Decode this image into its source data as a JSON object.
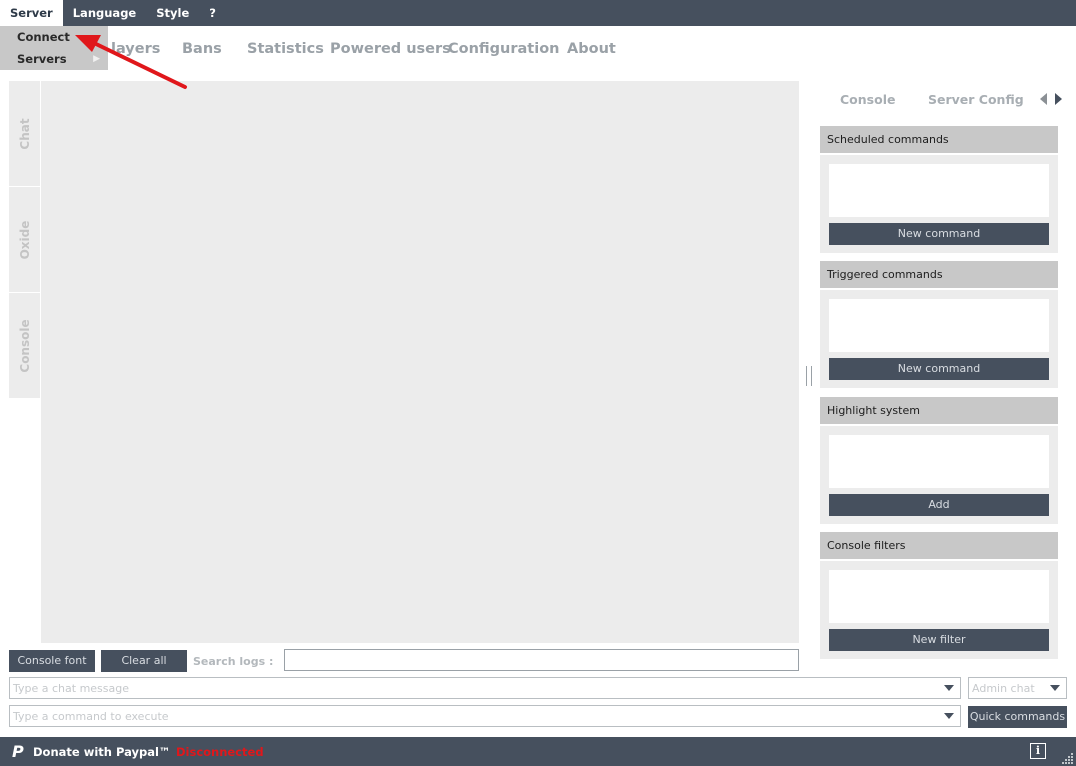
{
  "menubar": {
    "items": [
      {
        "label": "Server"
      },
      {
        "label": "Language"
      },
      {
        "label": "Style"
      },
      {
        "label": "?"
      }
    ]
  },
  "server_menu": {
    "items": [
      {
        "label": "Connect"
      },
      {
        "label": "Servers"
      }
    ]
  },
  "tabs": [
    {
      "label": "layers"
    },
    {
      "label": "Bans"
    },
    {
      "label": "Statistics"
    },
    {
      "label": "Powered users"
    },
    {
      "label": "Configuration"
    },
    {
      "label": "About"
    }
  ],
  "side_tabs": [
    {
      "label": "Chat"
    },
    {
      "label": "Oxide"
    },
    {
      "label": "Console"
    }
  ],
  "right_tabs": [
    {
      "label": "Console"
    },
    {
      "label": "Server Config"
    }
  ],
  "panels": [
    {
      "title": "Scheduled commands",
      "button": "New command"
    },
    {
      "title": "Triggered commands",
      "button": "New command"
    },
    {
      "title": "Highlight system",
      "button": "Add"
    },
    {
      "title": "Console filters",
      "button": "New filter"
    }
  ],
  "toolbar": {
    "console_font": "Console font",
    "clear_all": "Clear all",
    "search_label": "Search logs :"
  },
  "chat_input": {
    "placeholder": "Type a chat message"
  },
  "chat_target": {
    "value": "Admin chat"
  },
  "command_input": {
    "placeholder": "Type a command to execute"
  },
  "quick_commands": "Quick commands",
  "statusbar": {
    "donate": "Donate with Paypal™",
    "status": "Disconnected",
    "info_glyph": "i",
    "paypal_glyph": "P"
  },
  "colors": {
    "menubar_bg": "#46505e",
    "button_bg": "#46505e",
    "panel_header": "#c8c8c8",
    "status_disconnected": "#e0171b",
    "annotation_arrow": "#e0171b"
  }
}
